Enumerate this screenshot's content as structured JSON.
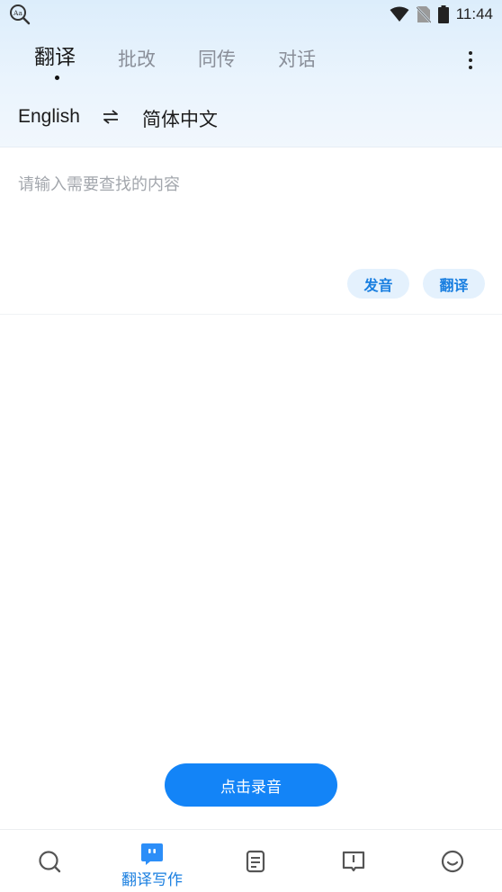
{
  "status_bar": {
    "left_icon": "dictionary-search-icon",
    "time": "11:44",
    "icons": [
      "wifi-icon",
      "no-sim-icon",
      "battery-icon"
    ]
  },
  "tabs": [
    {
      "label": "翻译",
      "active": true
    },
    {
      "label": "批改",
      "active": false
    },
    {
      "label": "同传",
      "active": false
    },
    {
      "label": "对话",
      "active": false
    }
  ],
  "language": {
    "source": "English",
    "swap_icon": "swap-arrows-icon",
    "target": "简体中文"
  },
  "input": {
    "value": "",
    "placeholder": "请输入需要查找的内容"
  },
  "actions": {
    "speak_label": "发音",
    "translate_label": "翻译"
  },
  "record": {
    "label": "点击录音"
  },
  "bottom_nav": [
    {
      "icon": "search-icon",
      "label": "",
      "active": false
    },
    {
      "icon": "chat-bot-icon",
      "label": "翻译写作",
      "active": true
    },
    {
      "icon": "document-icon",
      "label": "",
      "active": false
    },
    {
      "icon": "book-icon",
      "label": "",
      "active": false
    },
    {
      "icon": "smiley-icon",
      "label": "",
      "active": false
    }
  ],
  "colors": {
    "accent": "#1384f7",
    "pill_bg": "#e4f1fd",
    "header_gradient_top": "#dcedfb"
  }
}
